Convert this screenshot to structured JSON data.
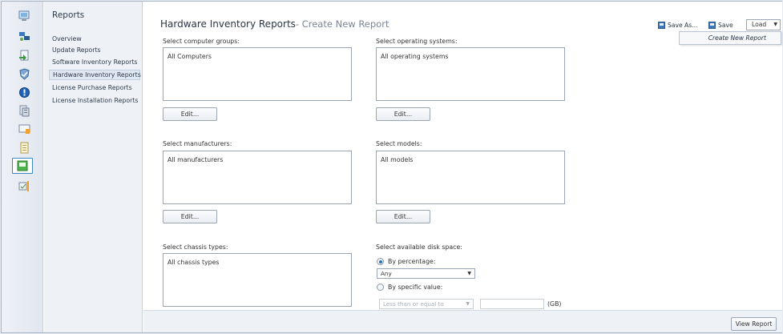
{
  "nav": {
    "title": "Reports",
    "items": [
      {
        "label": "Overview"
      },
      {
        "label": "Update Reports"
      },
      {
        "label": "Software Inventory Reports"
      },
      {
        "label": "Hardware Inventory Reports"
      },
      {
        "label": "License Purchase Reports"
      },
      {
        "label": "License Installation Reports"
      }
    ]
  },
  "strip_icons": [
    "computer-icon",
    "network-icon",
    "update-icon",
    "shield-icon",
    "alert-icon",
    "computers-list-icon",
    "monitor-icon",
    "document-icon",
    "reports-icon",
    "settings-icon"
  ],
  "header": {
    "title": "Hardware Inventory Reports",
    "subtitle": "- Create New Report"
  },
  "toolbar": {
    "save_as_label": "Save As...",
    "save_label": "Save",
    "load_label": "Load",
    "load_menu_item": "Create New Report"
  },
  "filters": {
    "computer_groups": {
      "label": "Select computer groups:",
      "value": "All Computers",
      "button": "Edit..."
    },
    "operating_systems": {
      "label": "Select operating systems:",
      "value": "All operating systems",
      "button": "Edit..."
    },
    "manufacturers": {
      "label": "Select manufacturers:",
      "value": "All manufacturers",
      "button": "Edit..."
    },
    "models": {
      "label": "Select models:",
      "value": "All models",
      "button": "Edit..."
    },
    "chassis_types": {
      "label": "Select chassis types:",
      "value": "All chassis types"
    },
    "disk_space": {
      "label": "Select available disk space:",
      "by_percentage_label": "By percentage:",
      "percentage_value": "Any",
      "by_value_label": "By specific value:",
      "comparison_value": "Less than or equal to",
      "unit": "(GB)"
    }
  },
  "footer": {
    "view_report_label": "View Report"
  },
  "colors": {
    "accent": "#2a6fb5",
    "selection_border": "#3c86c2"
  }
}
